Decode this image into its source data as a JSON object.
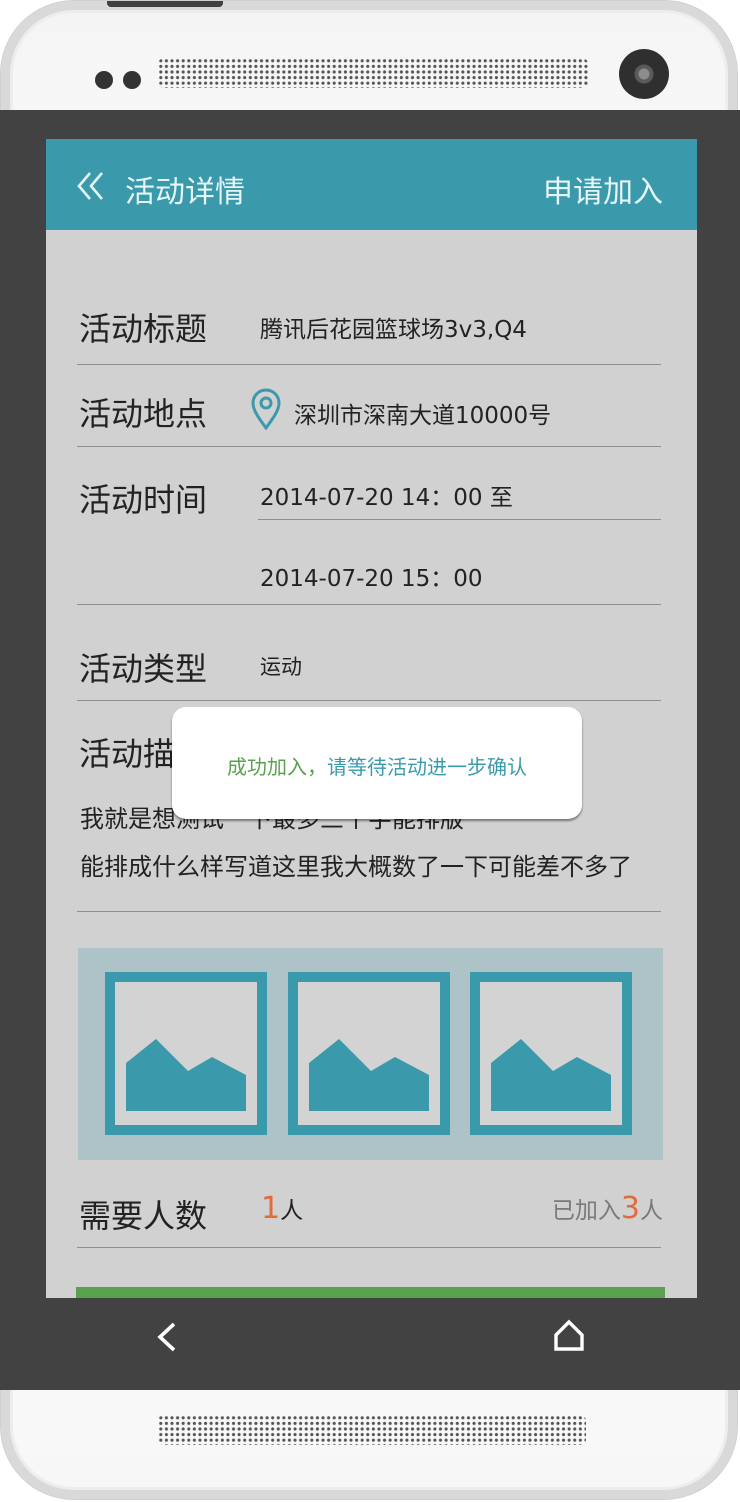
{
  "appbar": {
    "back_icon": "double-chevron-left-icon",
    "title": "活动详情",
    "apply_label": "申请加入"
  },
  "details": {
    "title_label": "活动标题",
    "title_value": "腾讯后花园篮球场3v3,Q4",
    "location_label": "活动地点",
    "location_icon": "map-pin-icon",
    "location_value": "深圳市深南大道10000号",
    "time_label": "活动时间",
    "time_start": "2014-07-20 14：00 至",
    "time_end": "2014-07-20 15：00",
    "type_label": "活动类型",
    "type_value": "运动",
    "desc_label": "活动描",
    "desc_line1": "我就是想测试一下最多三个字能排版",
    "desc_line2": "能排成什么样写道这里我大概数了一下可能差不多了"
  },
  "gallery": {
    "images": [
      "image-placeholder-icon",
      "image-placeholder-icon",
      "image-placeholder-icon"
    ]
  },
  "people": {
    "label": "需要人数",
    "needed_count": "1",
    "needed_unit": "人",
    "joined_prefix": "已加入",
    "joined_count": "3",
    "joined_unit": "人"
  },
  "toast": {
    "part1": "成功加入，",
    "part2": "请等待活动进一步确认"
  },
  "navbar": {
    "back_icon": "chevron-left-icon",
    "home_icon": "home-icon"
  },
  "colors": {
    "accent": "#3a9aab",
    "orange": "#e36a3a",
    "green": "#5aa14f",
    "toast_green": "#5aa14f"
  }
}
